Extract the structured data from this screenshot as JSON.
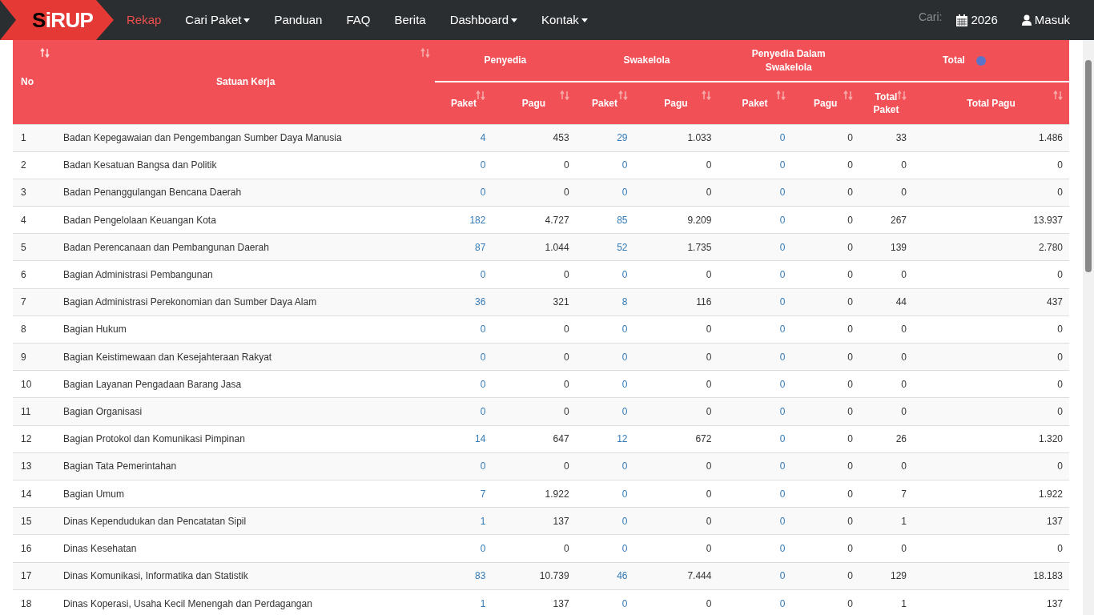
{
  "navbar": {
    "logo": "SiRUP",
    "items": [
      {
        "label": "Rekap",
        "selected": true,
        "dropdown": false
      },
      {
        "label": "Cari Paket",
        "selected": false,
        "dropdown": true
      },
      {
        "label": "Panduan",
        "selected": false,
        "dropdown": false
      },
      {
        "label": "FAQ",
        "selected": false,
        "dropdown": false
      },
      {
        "label": "Berita",
        "selected": false,
        "dropdown": false
      },
      {
        "label": "Dashboard",
        "selected": false,
        "dropdown": true
      },
      {
        "label": "Kontak",
        "selected": false,
        "dropdown": true
      }
    ],
    "search_label": "Cari:",
    "year": "2026",
    "login": "Masuk"
  },
  "table": {
    "header": {
      "no": "No",
      "unit": "Satuan Kerja",
      "groups": [
        "Penyedia",
        "Swakelola",
        "Penyedia Dalam Swakelola",
        "Total"
      ],
      "columns": [
        "Paket",
        "Pagu",
        "Paket",
        "Pagu",
        "Paket",
        "Pagu",
        "Total Paket",
        "Total Pagu"
      ]
    },
    "rows": [
      [
        "1",
        "Badan Kepegawaian dan Pengembangan Sumber Daya Manusia",
        "4",
        "453",
        "29",
        "1.033",
        "0",
        "0",
        "33",
        "1.486"
      ],
      [
        "2",
        "Badan Kesatuan Bangsa dan Politik",
        "0",
        "0",
        "0",
        "0",
        "0",
        "0",
        "0",
        "0"
      ],
      [
        "3",
        "Badan Penanggulangan Bencana Daerah",
        "0",
        "0",
        "0",
        "0",
        "0",
        "0",
        "0",
        "0"
      ],
      [
        "4",
        "Badan Pengelolaan Keuangan Kota",
        "182",
        "4.727",
        "85",
        "9.209",
        "0",
        "0",
        "267",
        "13.937"
      ],
      [
        "5",
        "Badan Perencanaan dan Pembangunan Daerah",
        "87",
        "1.044",
        "52",
        "1.735",
        "0",
        "0",
        "139",
        "2.780"
      ],
      [
        "6",
        "Bagian Administrasi Pembangunan",
        "0",
        "0",
        "0",
        "0",
        "0",
        "0",
        "0",
        "0"
      ],
      [
        "7",
        "Bagian Administrasi Perekonomian dan Sumber Daya Alam",
        "36",
        "321",
        "8",
        "116",
        "0",
        "0",
        "44",
        "437"
      ],
      [
        "8",
        "Bagian Hukum",
        "0",
        "0",
        "0",
        "0",
        "0",
        "0",
        "0",
        "0"
      ],
      [
        "9",
        "Bagian Keistimewaan dan Kesejahteraan Rakyat",
        "0",
        "0",
        "0",
        "0",
        "0",
        "0",
        "0",
        "0"
      ],
      [
        "10",
        "Bagian Layanan Pengadaan Barang Jasa",
        "0",
        "0",
        "0",
        "0",
        "0",
        "0",
        "0",
        "0"
      ],
      [
        "11",
        "Bagian Organisasi",
        "0",
        "0",
        "0",
        "0",
        "0",
        "0",
        "0",
        "0"
      ],
      [
        "12",
        "Bagian Protokol dan Komunikasi Pimpinan",
        "14",
        "647",
        "12",
        "672",
        "0",
        "0",
        "26",
        "1.320"
      ],
      [
        "13",
        "Bagian Tata Pemerintahan",
        "0",
        "0",
        "0",
        "0",
        "0",
        "0",
        "0",
        "0"
      ],
      [
        "14",
        "Bagian Umum",
        "7",
        "1.922",
        "0",
        "0",
        "0",
        "0",
        "7",
        "1.922"
      ],
      [
        "15",
        "Dinas Kependudukan dan Pencatatan Sipil",
        "1",
        "137",
        "0",
        "0",
        "0",
        "0",
        "1",
        "137"
      ],
      [
        "16",
        "Dinas Kesehatan",
        "0",
        "0",
        "0",
        "0",
        "0",
        "0",
        "0",
        "0"
      ],
      [
        "17",
        "Dinas Komunikasi, Informatika dan Statistik",
        "83",
        "10.739",
        "46",
        "7.444",
        "0",
        "0",
        "129",
        "18.183"
      ],
      [
        "18",
        "Dinas Koperasi, Usaha Kecil Menengah dan Perdagangan",
        "1",
        "137",
        "0",
        "0",
        "0",
        "0",
        "1",
        "137"
      ]
    ]
  }
}
